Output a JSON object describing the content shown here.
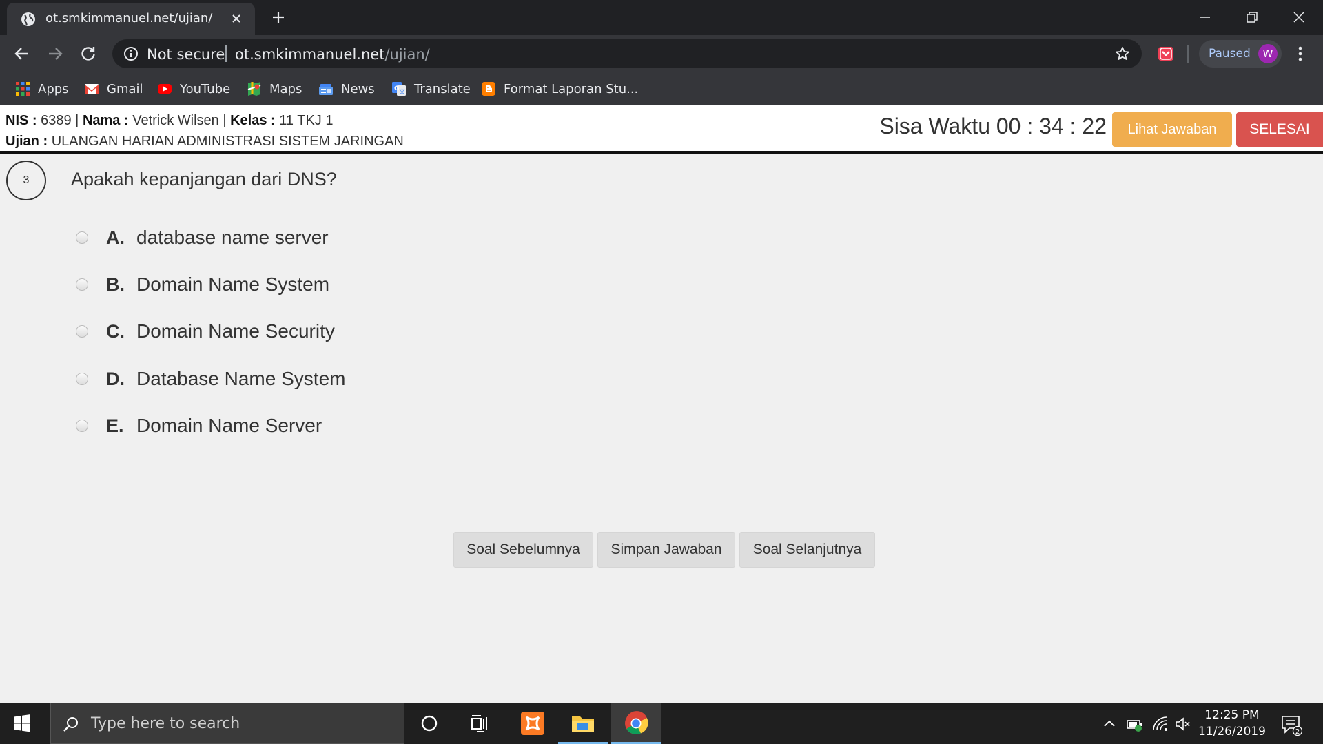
{
  "browser": {
    "tab_title": "ot.smkimmanuel.net/ujian/",
    "security_label": "Not secure",
    "url_host": "ot.smkimmanuel.net",
    "url_path": "/ujian/",
    "profile_label": "Paused",
    "profile_initial": "W"
  },
  "bookmarks": [
    {
      "label": "Apps",
      "icon": "apps-grid-icon"
    },
    {
      "label": "Gmail",
      "icon": "gmail-icon"
    },
    {
      "label": "YouTube",
      "icon": "youtube-icon"
    },
    {
      "label": "Maps",
      "icon": "maps-icon"
    },
    {
      "label": "News",
      "icon": "news-icon"
    },
    {
      "label": "Translate",
      "icon": "translate-icon"
    },
    {
      "label": "Format Laporan Stu...",
      "icon": "blogger-icon"
    }
  ],
  "exam": {
    "nis_label": "NIS :",
    "nis": "6389",
    "nama_label": "Nama :",
    "nama": "Vetrick Wilsen",
    "kelas_label": "Kelas :",
    "kelas": "11 TKJ 1",
    "ujian_label": "Ujian :",
    "ujian": "ULANGAN HARIAN ADMINISTRASI SISTEM JARINGAN",
    "timer_label": "Sisa Waktu",
    "timer": "00 : 34 : 22",
    "lihat_label": "Lihat Jawaban",
    "selesai_label": "SELESAI",
    "colors": {
      "warning": "#f0ad4e",
      "danger": "#d9534f"
    }
  },
  "question": {
    "number": "3",
    "text": "Apakah kepanjangan dari DNS?",
    "options": [
      {
        "letter": "A.",
        "text": "database name server"
      },
      {
        "letter": "B.",
        "text": "Domain Name System"
      },
      {
        "letter": "C.",
        "text": "Domain Name Security"
      },
      {
        "letter": "D.",
        "text": "Database Name System"
      },
      {
        "letter": "E.",
        "text": "Domain Name Server"
      }
    ]
  },
  "nav": {
    "prev_label": "Soal Sebelumnya",
    "save_label": "Simpan Jawaban",
    "next_label": "Soal Selanjutnya"
  },
  "taskbar": {
    "search_placeholder": "Type here to search",
    "time": "12:25 PM",
    "date": "11/26/2019",
    "notification_count": "2"
  }
}
